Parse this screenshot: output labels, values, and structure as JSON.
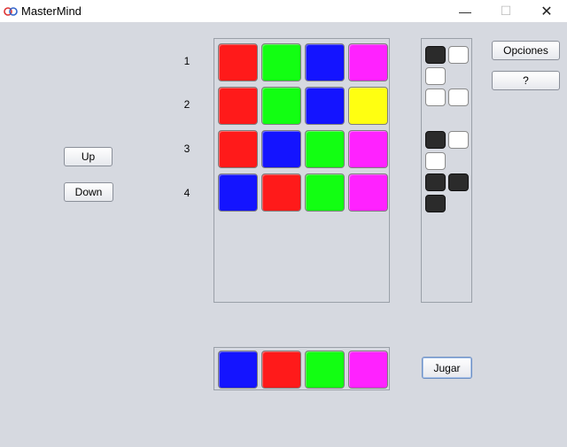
{
  "window": {
    "title": "MasterMind",
    "minimize_glyph": "—",
    "maximize_glyph": "☐",
    "close_glyph": "✕"
  },
  "colors": {
    "red": "#ff1a1a",
    "green": "#12ff12",
    "blue": "#1414ff",
    "magenta": "#ff22ff",
    "yellow": "#ffff11",
    "feedback_black": "#2b2b2b",
    "feedback_white": "#ffffff"
  },
  "controls": {
    "up_label": "Up",
    "down_label": "Down",
    "options_label": "Opciones",
    "help_label": "?",
    "play_label": "Jugar"
  },
  "board": {
    "rows": [
      {
        "number": "1",
        "pegs": [
          "red",
          "green",
          "blue",
          "magenta"
        ]
      },
      {
        "number": "2",
        "pegs": [
          "red",
          "green",
          "blue",
          "yellow"
        ]
      },
      {
        "number": "3",
        "pegs": [
          "red",
          "blue",
          "green",
          "magenta"
        ]
      },
      {
        "number": "4",
        "pegs": [
          "blue",
          "red",
          "green",
          "magenta"
        ]
      }
    ]
  },
  "feedback": {
    "pegs": [
      "black",
      "white",
      "white",
      "white",
      "white",
      "black",
      "white",
      "white",
      "black",
      "black",
      "black"
    ]
  },
  "current_guess": {
    "pegs": [
      "blue",
      "red",
      "green",
      "magenta"
    ]
  }
}
